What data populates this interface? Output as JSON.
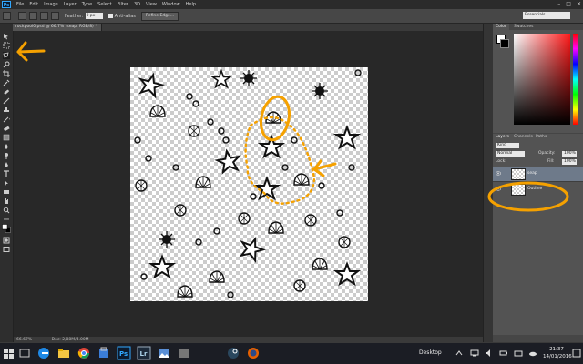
{
  "menubar": {
    "logo": "Ps",
    "items": [
      "File",
      "Edit",
      "Image",
      "Layer",
      "Type",
      "Select",
      "Filter",
      "3D",
      "View",
      "Window",
      "Help"
    ],
    "window_controls": [
      "–",
      "□",
      "✕"
    ]
  },
  "options": {
    "feather_label": "Feather:",
    "feather_value": "0 px",
    "antialias_label": "Anti-alias",
    "refine_label": "Refine Edge...",
    "workspace": "Essentials"
  },
  "document": {
    "tab_title": "rockpool0.psd @ 66.7% (seap, RGB/8) *",
    "zoom": "66.67%",
    "doc_size": "Doc: 2,88M/4.00M"
  },
  "color_panel": {
    "tabs": [
      "Color",
      "Swatches"
    ]
  },
  "layers_panel": {
    "tabs": [
      "Layers",
      "Channels",
      "Paths"
    ],
    "kind_label": "Kind",
    "blend_mode": "Normal",
    "opacity_label": "Opacity:",
    "opacity_value": "100%",
    "lock_label": "Lock:",
    "fill_label": "Fill:",
    "fill_value": "100%",
    "layers": [
      {
        "name": "seap",
        "selected": true
      },
      {
        "name": "Outline",
        "selected": false
      }
    ]
  },
  "taskbar": {
    "apps": [
      "edge-icon",
      "file-explorer-icon",
      "chrome-icon",
      "store-icon",
      "photoshop-icon",
      "lightroom-icon",
      "photos-icon",
      "app-icon",
      "steam-icon",
      "firefox-icon"
    ],
    "desktop_label": "Desktop",
    "time": "21:37",
    "date": "14/01/2016"
  },
  "colors": {
    "annotation": "#f5a100",
    "ps_blue": "#31a8ff"
  }
}
